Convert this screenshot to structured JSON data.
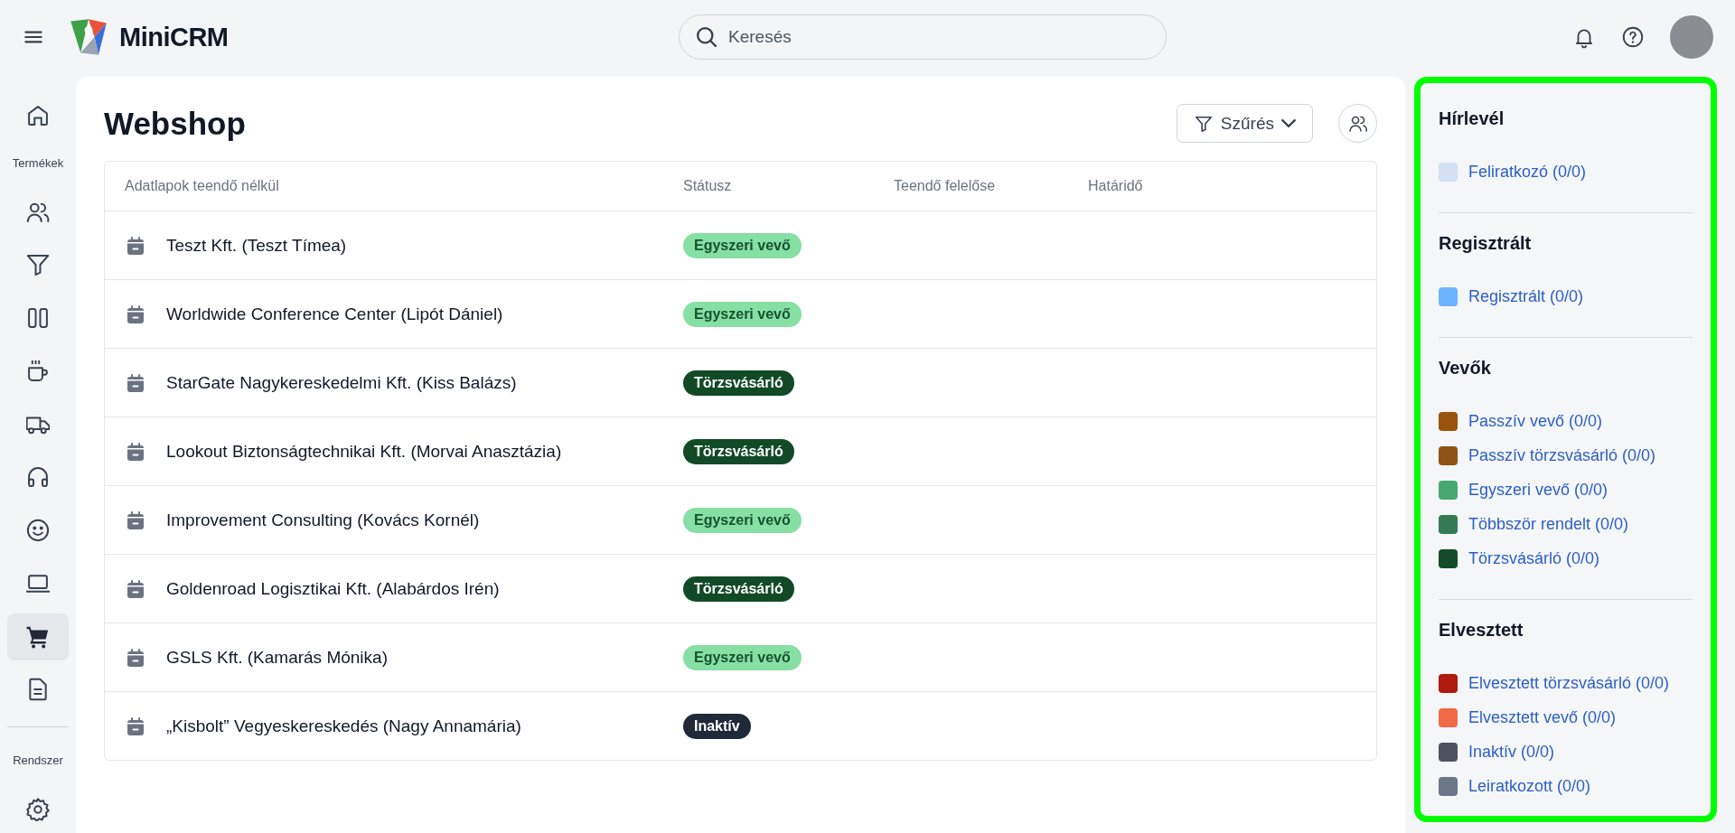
{
  "header": {
    "logo_text": "MiniCRM",
    "search": {
      "placeholder": "Keresés"
    }
  },
  "sidebar": {
    "items": [
      {
        "kind": "nav",
        "selected": false
      },
      {
        "kind": "label",
        "text": "Termékek"
      },
      {
        "kind": "nav",
        "selected": false
      },
      {
        "kind": "nav",
        "selected": false
      },
      {
        "kind": "nav",
        "selected": false
      },
      {
        "kind": "nav",
        "selected": false
      },
      {
        "kind": "nav",
        "selected": false
      },
      {
        "kind": "nav",
        "selected": false
      },
      {
        "kind": "nav",
        "selected": false
      },
      {
        "kind": "nav",
        "selected": false
      },
      {
        "kind": "nav",
        "selected": true
      },
      {
        "kind": "nav",
        "selected": false
      },
      {
        "kind": "divider"
      },
      {
        "kind": "label",
        "text": "Rendszer"
      },
      {
        "kind": "nav",
        "selected": false
      }
    ]
  },
  "page": {
    "title": "Webshop",
    "filter_button": "Szűrés"
  },
  "table": {
    "columns": [
      "Adatlapok teendő nélkül",
      "Státusz",
      "Teendő felelőse",
      "Határidő"
    ],
    "rows": [
      {
        "name": "Teszt Kft. (Teszt Tímea)",
        "status": {
          "label": "Egyszeri vevő",
          "kind": "light"
        }
      },
      {
        "name": "Worldwide Conference Center (Lipót Dániel)",
        "status": {
          "label": "Egyszeri vevő",
          "kind": "light"
        }
      },
      {
        "name": "StarGate Nagykereskedelmi Kft. (Kiss Balázs)",
        "status": {
          "label": "Törzsvásárló",
          "kind": "dark"
        }
      },
      {
        "name": "Lookout Biztonságtechnikai Kft. (Morvai Anasztázia)",
        "status": {
          "label": "Törzsvásárló",
          "kind": "dark"
        }
      },
      {
        "name": "Improvement Consulting (Kovács Kornél)",
        "status": {
          "label": "Egyszeri vevő",
          "kind": "light"
        }
      },
      {
        "name": "Goldenroad Logisztikai Kft. (Alabárdos Irén)",
        "status": {
          "label": "Törzsvásárló",
          "kind": "dark"
        }
      },
      {
        "name": "GSLS Kft. (Kamarás Mónika)",
        "status": {
          "label": "Egyszeri vevő",
          "kind": "light"
        }
      },
      {
        "name": "„Kisbolt” Vegyeskereskedés (Nagy Annamária)",
        "status": {
          "label": "Inaktív",
          "kind": "inactive"
        }
      }
    ]
  },
  "legend": [
    {
      "title": "Hírlevél",
      "items": [
        {
          "label": "Feliratkozó (0/0)",
          "color": "#d3e1f5"
        }
      ]
    },
    {
      "title": "Regisztrált",
      "items": [
        {
          "label": "Regisztrált (0/0)",
          "color": "#6cb4ff"
        }
      ]
    },
    {
      "title": "Vevők",
      "items": [
        {
          "label": "Passzív vevő (0/0)",
          "color": "#98530c"
        },
        {
          "label": "Passzív törzsvásárló (0/0)",
          "color": "#8f5216"
        },
        {
          "label": "Egyszeri vevő (0/0)",
          "color": "#45a96f"
        },
        {
          "label": "Többször rendelt (0/0)",
          "color": "#357a55"
        },
        {
          "label": "Törzsvásárló (0/0)",
          "color": "#144b2a"
        }
      ]
    },
    {
      "title": "Elvesztett",
      "items": [
        {
          "label": "Elvesztett törzsvásárló (0/0)",
          "color": "#b11a0f"
        },
        {
          "label": "Elvesztett vevő (0/0)",
          "color": "#f26a48"
        },
        {
          "label": "Inaktív (0/0)",
          "color": "#4b5361"
        },
        {
          "label": "Leiratkozott (0/0)",
          "color": "#6b7687"
        }
      ]
    }
  ]
}
